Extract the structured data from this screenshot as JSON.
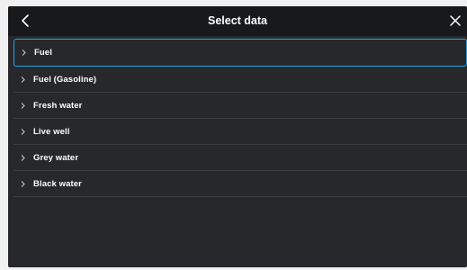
{
  "header": {
    "title": "Select data",
    "back_icon": "chevron-left-icon",
    "close_icon": "close-icon"
  },
  "list": {
    "selected_index": 0,
    "items": [
      {
        "label": "Fuel",
        "icon": "chevron-right-icon"
      },
      {
        "label": "Fuel (Gasoline)",
        "icon": "chevron-right-icon"
      },
      {
        "label": "Fresh water",
        "icon": "chevron-right-icon"
      },
      {
        "label": "Live well",
        "icon": "chevron-right-icon"
      },
      {
        "label": "Grey water",
        "icon": "chevron-right-icon"
      },
      {
        "label": "Black water",
        "icon": "chevron-right-icon"
      }
    ]
  },
  "colors": {
    "background": "#26282c",
    "header": "#17191b",
    "accent": "#2aa3e0",
    "divider": "#3a3d42",
    "text": "#ffffff"
  }
}
